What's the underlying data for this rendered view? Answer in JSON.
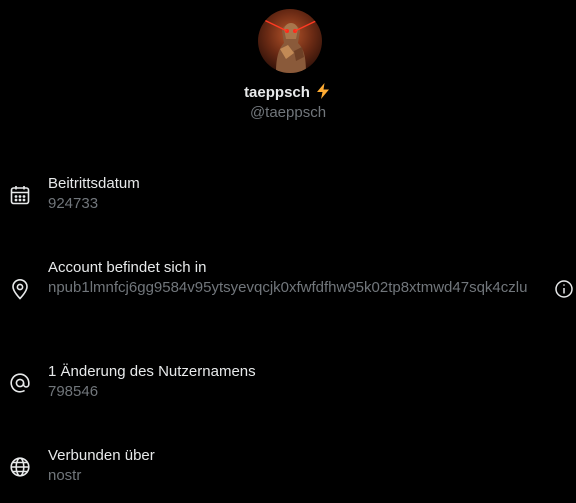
{
  "profile": {
    "display_name": "taeppsch",
    "handle": "@taeppsch",
    "avatar_icon": "avatar-image",
    "badge_icon": "lightning-bolt-icon"
  },
  "rows": [
    {
      "icon": "calendar-icon",
      "label": "Beitrittsdatum",
      "value": "924733"
    },
    {
      "icon": "location-pin-icon",
      "label": "Account befindet sich in",
      "value": "npub1lmnfcj6gg9584v95ytsyevqcjk0xfwfdfhw95k02tp8xtmwd47sqk4czlu",
      "info_icon": "info-icon"
    },
    {
      "icon": "at-sign-icon",
      "label": "1 Änderung des Nutzernamens",
      "value": "798546"
    },
    {
      "icon": "globe-icon",
      "label": "Verbunden über",
      "value": "nostr"
    }
  ],
  "colors": {
    "background": "#000000",
    "primary_text": "#e7e9ea",
    "secondary_text": "#71767b",
    "bolt": "#ffac33"
  }
}
